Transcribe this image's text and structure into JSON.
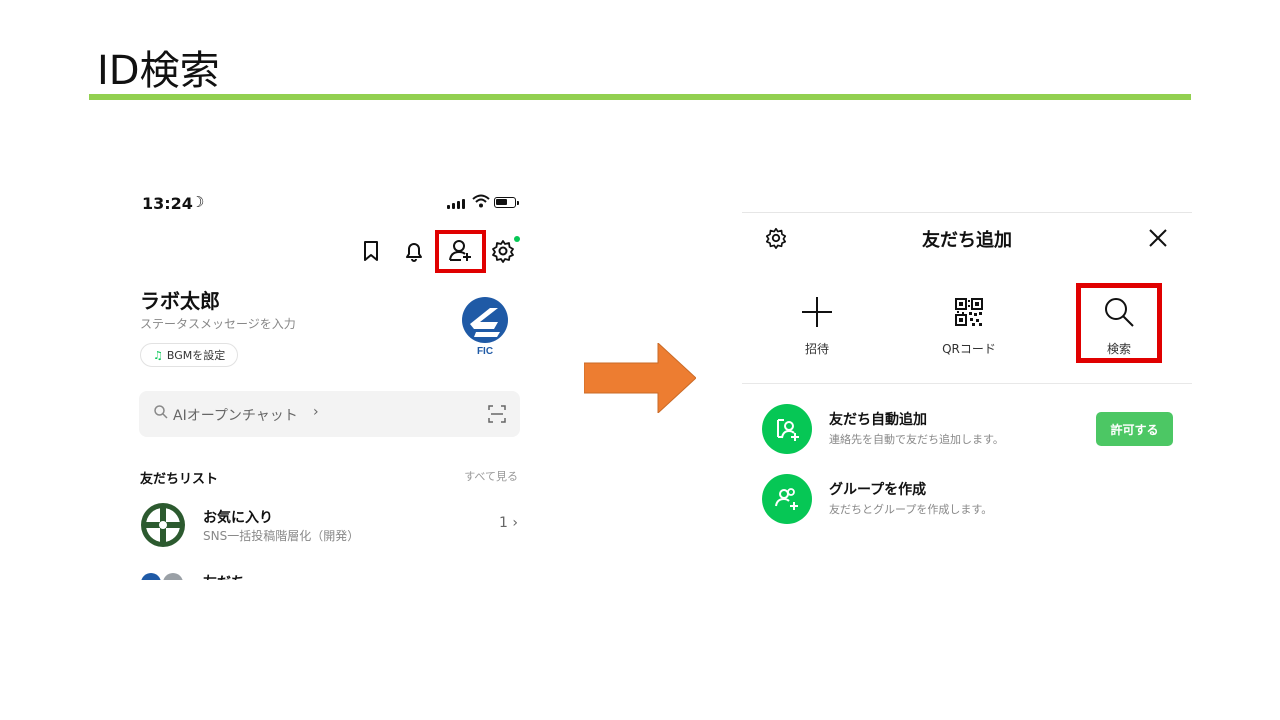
{
  "slide": {
    "title": "ID検索"
  },
  "left_screen": {
    "status_time": "13:24",
    "profile": {
      "name": "ラボ太郎",
      "status_placeholder": "ステータスメッセージを入力",
      "bgm_label": "BGMを設定",
      "logo_text": "FIC"
    },
    "search": {
      "label": "AIオープンチャット"
    },
    "friends": {
      "header": "友だちリスト",
      "see_all": "すべて見る",
      "favorites": {
        "title": "お気に入り",
        "subtitle": "SNS一括投稿階層化（開発）",
        "count": "1"
      },
      "next_row_peek": "友だち"
    },
    "top_icons": [
      "bookmark-icon",
      "bell-icon",
      "add-friend-icon",
      "gear-icon"
    ]
  },
  "right_screen": {
    "title": "友だち追加",
    "actions": [
      {
        "label": "招待",
        "icon": "plus-icon"
      },
      {
        "label": "QRコード",
        "icon": "qr-icon"
      },
      {
        "label": "検索",
        "icon": "search-icon"
      }
    ],
    "rows": [
      {
        "title": "友だち自動追加",
        "subtitle": "連絡先を自動で友だち追加します。",
        "button": "許可する"
      },
      {
        "title": "グループを作成",
        "subtitle": "友だちとグループを作成します。"
      }
    ]
  },
  "colors": {
    "accent_green": "#06c755",
    "title_rule": "#92d050",
    "highlight_red": "#e00000",
    "arrow_orange": "#ed7d31"
  }
}
